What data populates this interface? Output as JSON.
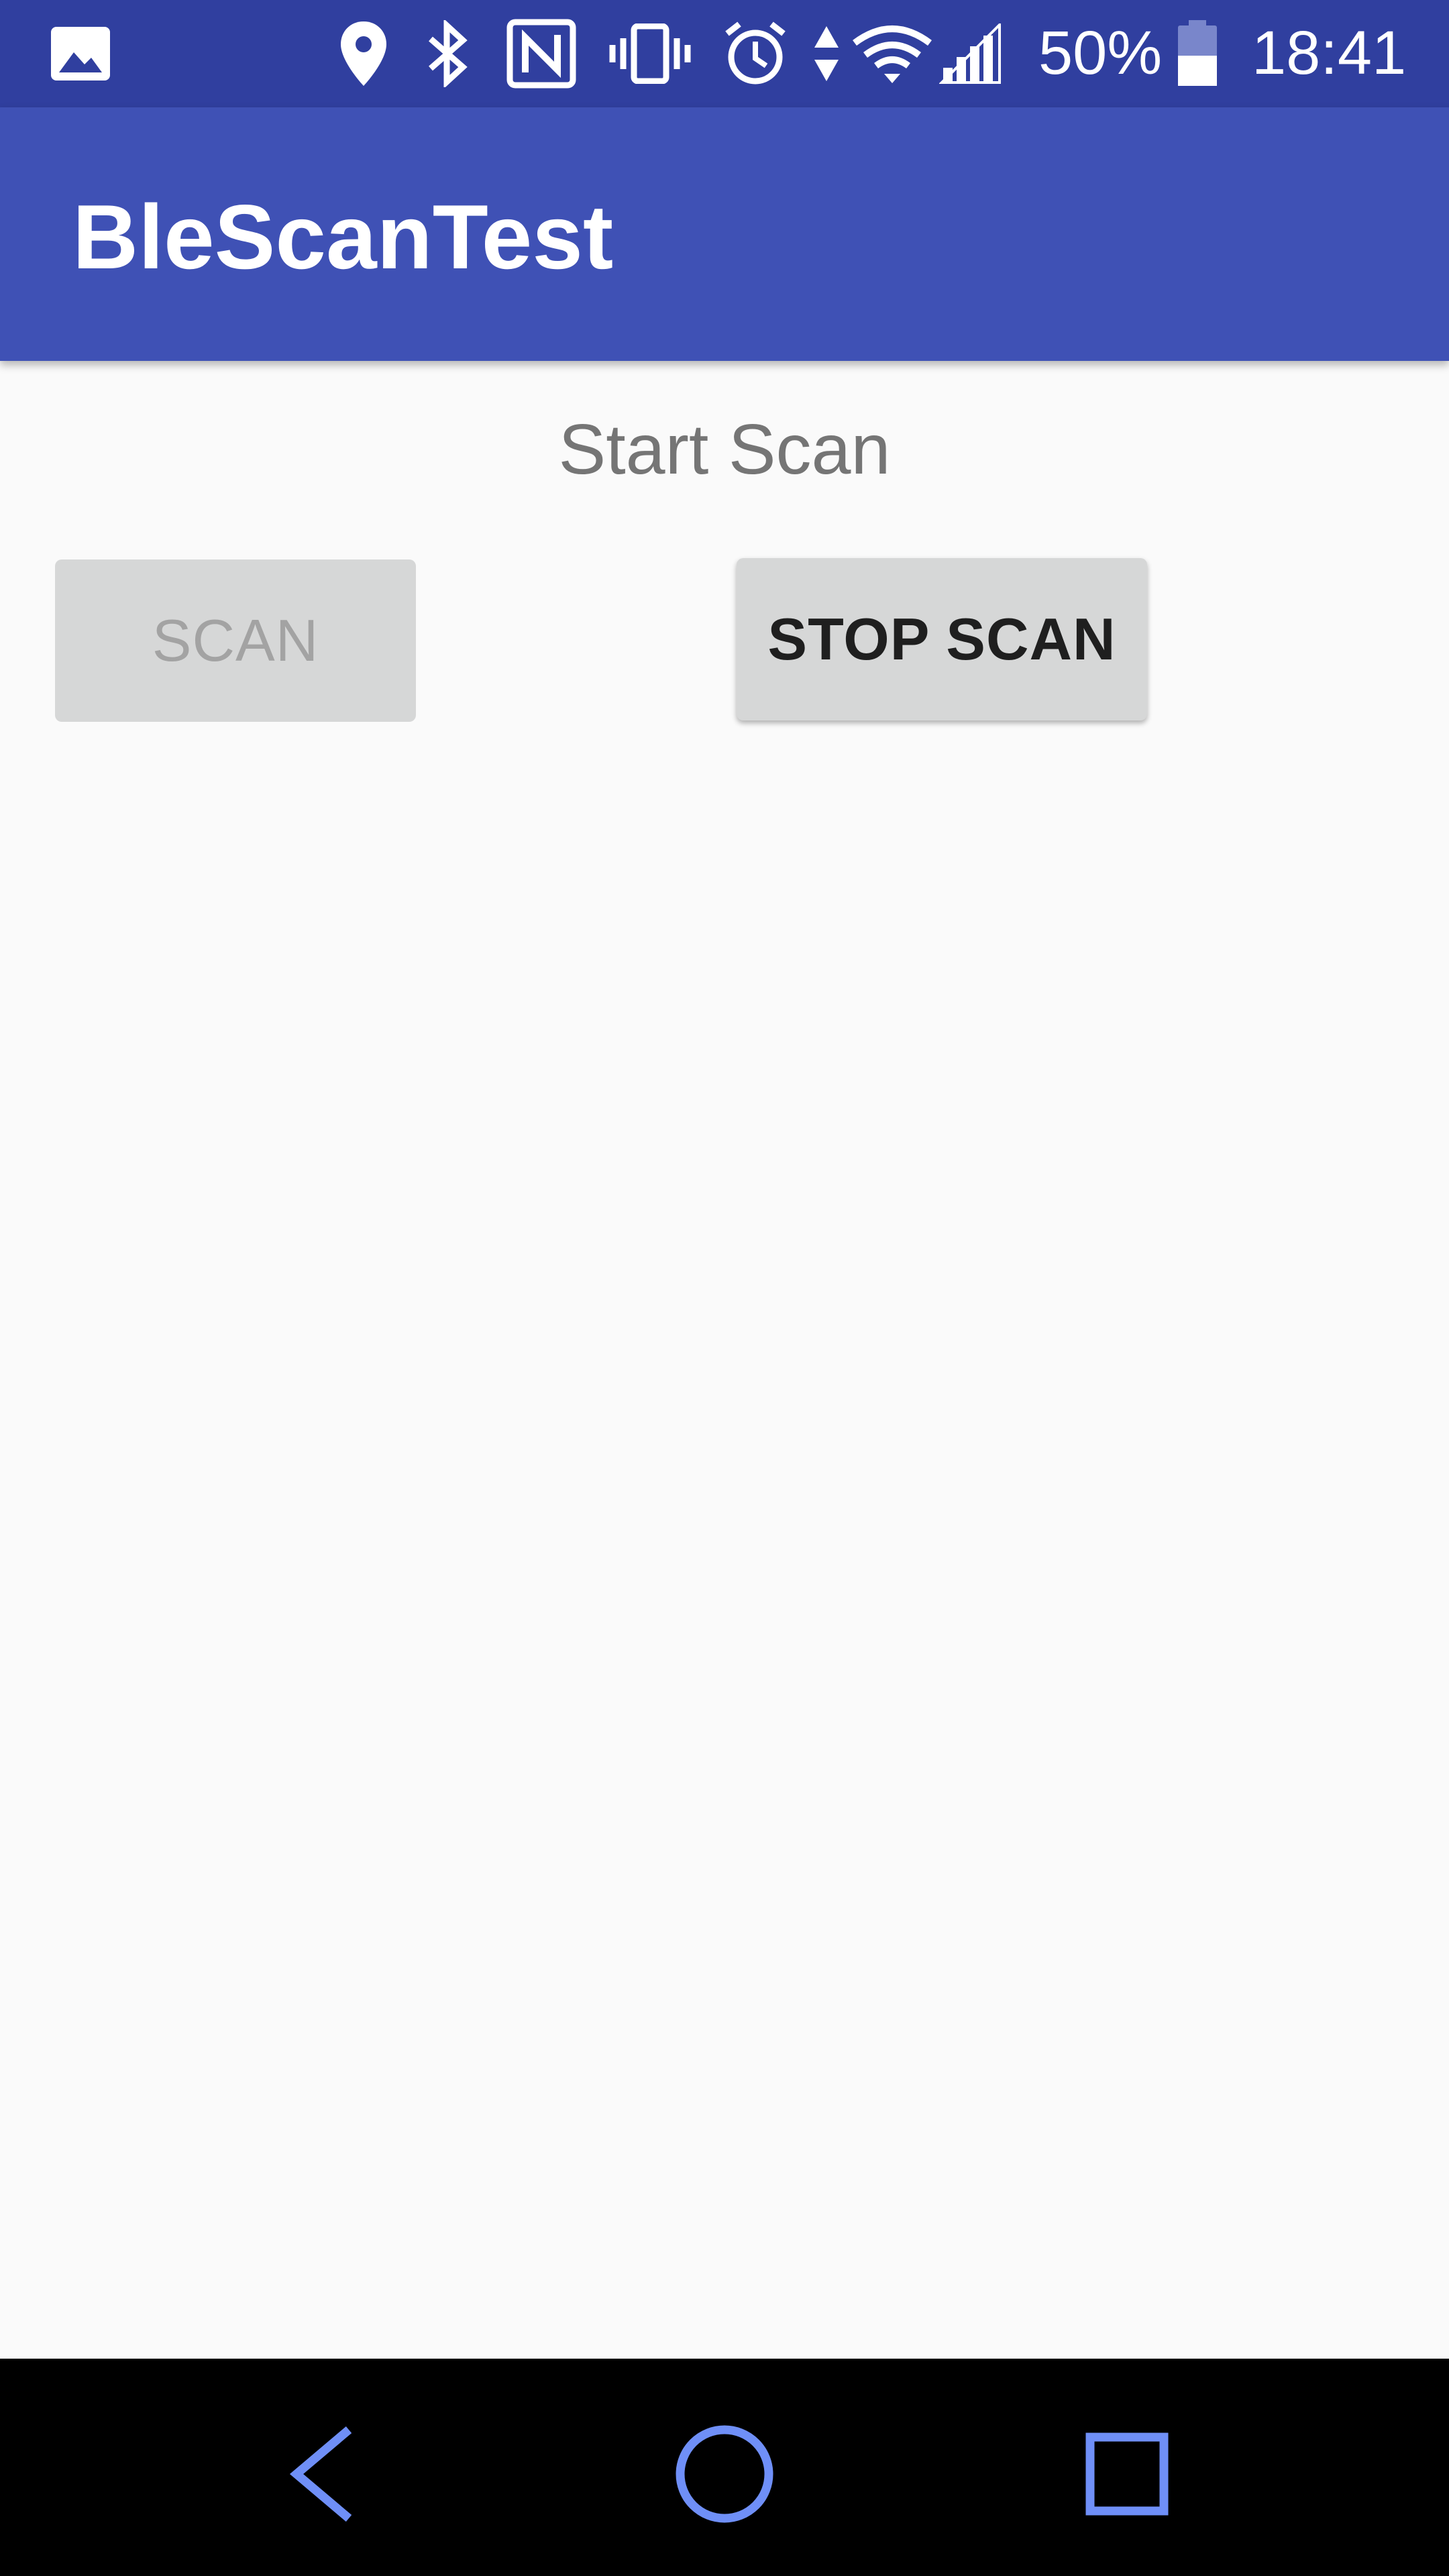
{
  "status_bar": {
    "battery_percent": "50%",
    "time": "18:41",
    "icons": [
      "image-icon",
      "location-icon",
      "bluetooth-icon",
      "nfc-icon",
      "vibrate-icon",
      "alarm-icon",
      "data-transfer-icon",
      "wifi-icon",
      "cellular-signal-icon",
      "battery-icon"
    ],
    "battery_level": 0.5,
    "background_color": "#303f9f"
  },
  "app_bar": {
    "title": "BleScanTest",
    "background_color": "#3f51b5"
  },
  "main": {
    "status_text": "Start Scan",
    "scan_button_label": "SCAN",
    "scan_button_enabled": false,
    "stop_scan_button_label": "STOP SCAN",
    "stop_scan_button_enabled": true,
    "background_color": "#fafafa"
  },
  "nav_bar": {
    "buttons": [
      "back-icon",
      "home-icon",
      "recents-icon"
    ],
    "icon_color": "#6f8ff7"
  }
}
